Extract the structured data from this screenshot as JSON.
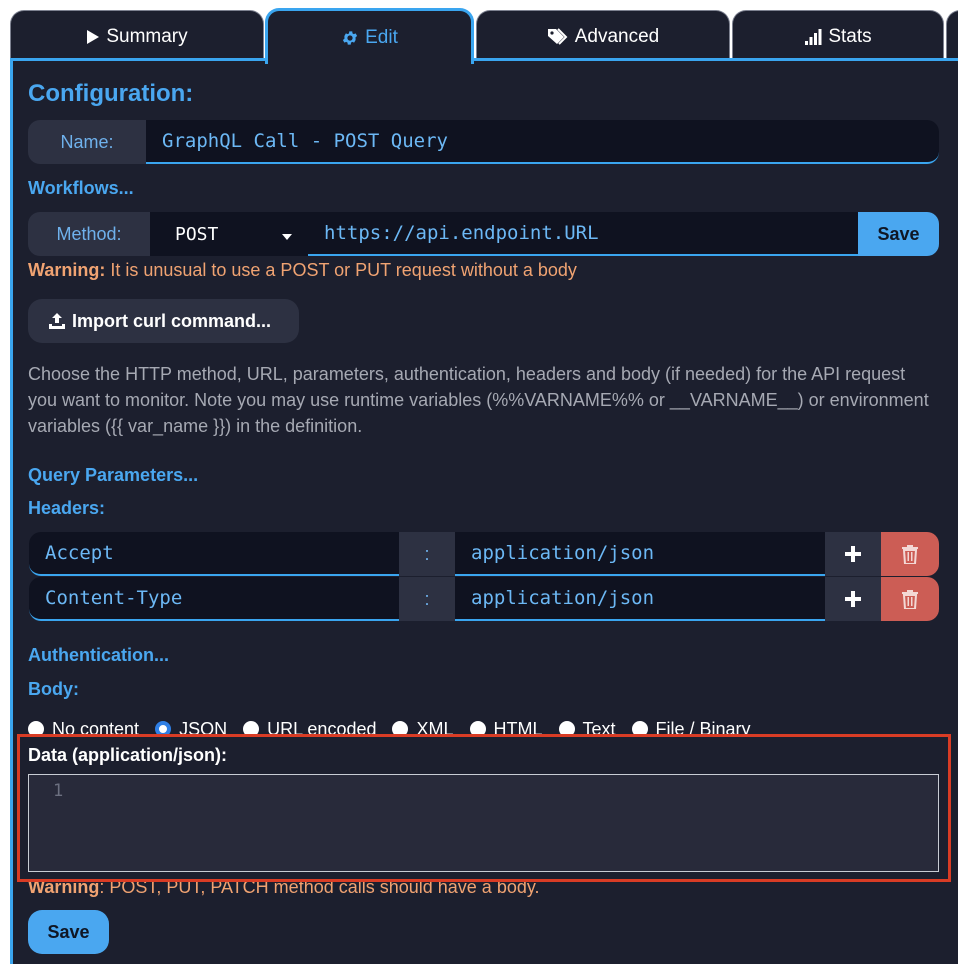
{
  "tabs": [
    {
      "label": "Summary",
      "icon": "play-icon"
    },
    {
      "label": "Edit",
      "icon": "gear-icon"
    },
    {
      "label": "Advanced",
      "icon": "tags-icon"
    },
    {
      "label": "Stats",
      "icon": "signal-bars-icon"
    }
  ],
  "config": {
    "title": "Configuration:",
    "name_label": "Name:",
    "name_value": "GraphQL Call - POST Query",
    "workflows_link": "Workflows...",
    "method_label": "Method:",
    "method_value": "POST",
    "url_value": "https://api.endpoint.URL",
    "save_label": "Save",
    "warning_prefix": "Warning:",
    "warning_text": " It is unusual to use a POST or PUT request without a body",
    "import_label": "Import curl command...",
    "help_text": "Choose the HTTP method, URL, parameters, authentication, headers and body (if needed) for the API request you want to monitor. Note you may use runtime variables (%%VARNAME%% or __VARNAME__) or environment variables ({{ var_name }}) in the definition."
  },
  "query_params_link": "Query Parameters...",
  "headers": {
    "title": "Headers:",
    "separator": ":",
    "rows": [
      {
        "key": "Accept",
        "value": "application/json"
      },
      {
        "key": "Content-Type",
        "value": "application/json"
      }
    ]
  },
  "authentication_link": "Authentication...",
  "body": {
    "title": "Body:",
    "options": [
      "No content",
      "JSON",
      "URL encoded",
      "XML",
      "HTML",
      "Text",
      "File / Binary"
    ],
    "selected": "JSON",
    "data_label": "Data (application/json):",
    "line_number": "1",
    "warning_prefix": "Warning",
    "warning_text": ": POST, PUT, PATCH method calls should have a body.",
    "save_label": "Save"
  },
  "colors": {
    "accent": "#3aa5ef",
    "background": "#1c1f2e",
    "warning": "#f0a372",
    "danger": "#cc5d55",
    "highlight": "#d93c25"
  }
}
